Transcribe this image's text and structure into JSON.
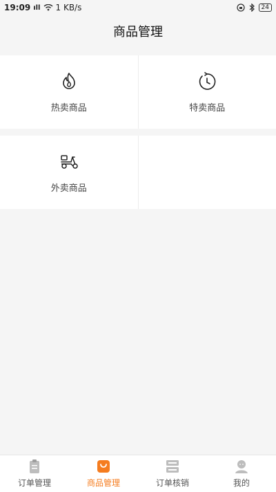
{
  "status_bar": {
    "time": "19:09",
    "signal": "ıll",
    "speed": "1 KB/s",
    "battery": "24"
  },
  "header": {
    "title": "商品管理"
  },
  "tiles": [
    {
      "label": "热卖商品",
      "icon": "flame-icon"
    },
    {
      "label": "特卖商品",
      "icon": "clock-icon"
    },
    {
      "label": "外卖商品",
      "icon": "scooter-icon"
    }
  ],
  "tabbar": {
    "items": [
      {
        "label": "订单管理",
        "icon": "clipboard-icon",
        "active": false
      },
      {
        "label": "商品管理",
        "icon": "bag-icon",
        "active": true
      },
      {
        "label": "订单核销",
        "icon": "server-icon",
        "active": false
      },
      {
        "label": "我的",
        "icon": "user-icon",
        "active": false
      }
    ]
  },
  "colors": {
    "accent": "#f57c1f",
    "background": "#f5f5f5",
    "tile": "#ffffff"
  }
}
